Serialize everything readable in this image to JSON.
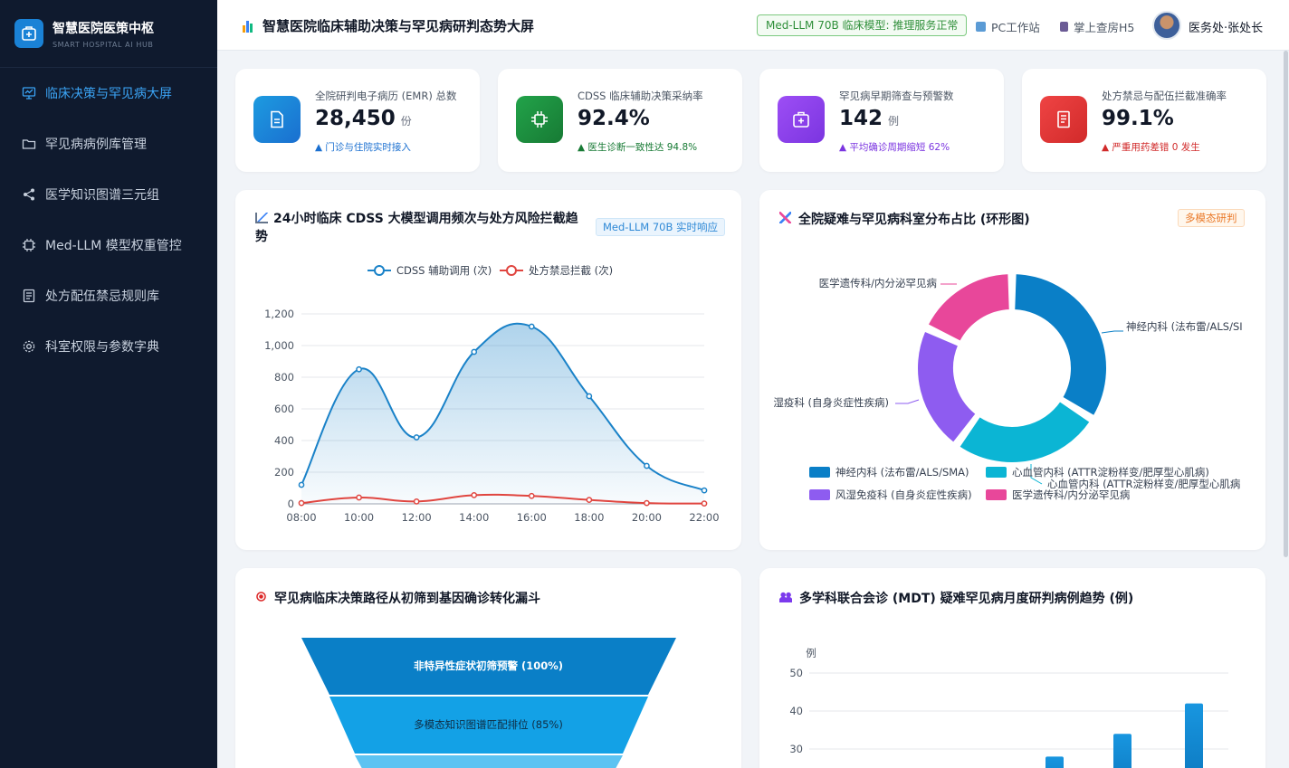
{
  "app": {
    "name": "智慧医院医策中枢",
    "subtitle": "SMART HOSPITAL AI HUB"
  },
  "sidebar": {
    "items": [
      {
        "label": "临床决策与罕见病大屏",
        "icon": "dashboard-icon",
        "active": true
      },
      {
        "label": "罕见病病例库管理",
        "icon": "folder-icon",
        "active": false
      },
      {
        "label": "医学知识图谱三元组",
        "icon": "share-icon",
        "active": false
      },
      {
        "label": "Med-LLM 模型权重管控",
        "icon": "chip-icon",
        "active": false
      },
      {
        "label": "处方配伍禁忌规则库",
        "icon": "document-icon",
        "active": false
      },
      {
        "label": "科室权限与参数字典",
        "icon": "gear-icon",
        "active": false
      }
    ]
  },
  "header": {
    "title": "智慧医院临床辅助决策与罕见病研判态势大屏",
    "model_status": "Med-LLM 70B 临床模型: 推理服务正常",
    "pc_link": "PC工作站",
    "h5_link": "掌上查房H5",
    "user": "医务处·张处长"
  },
  "kpis": [
    {
      "label": "全院研判电子病历 (EMR) 总数",
      "value": "28,450",
      "unit": "份",
      "trend": "▲ 门诊与住院实时接入",
      "color": "#1a82d6",
      "icon": "document-icon"
    },
    {
      "label": "CDSS 临床辅助决策采纳率",
      "value": "92.4%",
      "unit": "",
      "trend": "▲ 医生诊断一致性达 94.8%",
      "color": "#1f8f3c",
      "icon": "chip-icon"
    },
    {
      "label": "罕见病早期筛查与预警数",
      "value": "142",
      "unit": "例",
      "trend": "▲ 平均确诊周期缩短 62%",
      "color": "#8b3ff0",
      "icon": "medical-kit-icon"
    },
    {
      "label": "处方禁忌与配伍拦截准确率",
      "value": "99.1%",
      "unit": "",
      "trend": "▲ 严重用药差错 0 发生",
      "color": "#dc2626",
      "icon": "prescription-icon"
    }
  ],
  "colors": {
    "accent": "#1a82d6",
    "cdss_line": "#1a82c8",
    "intercept_line": "#e0453f"
  },
  "line_panel": {
    "title_line1": "24小时临床 CDSS 大模型调用频次与处方风险拦截趋",
    "title_line2": "势",
    "tag": "Med-LLM 70B 实时响应"
  },
  "donut_panel": {
    "title": "全院疑难与罕见病科室分布占比 (环形图)",
    "tag": "多模态研判",
    "label_genetics": "医学遗传科/内分泌罕见病",
    "label_neuro": "神经内科 (法布雷/ALS/SI",
    "label_rheum": "湿疫科 (自身炎症性疾病)",
    "label_cardio": "心血管内科 (ATTR淀粉样变/肥厚型心肌病"
  },
  "funnel_panel": {
    "title": "罕见病临床决策路径从初筛到基因确诊转化漏斗",
    "stages": [
      "非特异性症状初筛预警 (100%)",
      "多模态知识图谱匹配排位 (85%)"
    ]
  },
  "bar_panel": {
    "title": "多学科联合会诊 (MDT) 疑难罕见病月度研判病例趋势 (例)"
  },
  "chart_data": [
    {
      "type": "line",
      "x": [
        "08:00",
        "10:00",
        "12:00",
        "14:00",
        "16:00",
        "18:00",
        "20:00",
        "22:00"
      ],
      "series": [
        {
          "name": "CDSS 辅助调用 (次)",
          "values": [
            120,
            850,
            420,
            960,
            1120,
            680,
            240,
            85
          ]
        },
        {
          "name": "处方禁忌拦截 (次)",
          "values": [
            5,
            40,
            15,
            55,
            50,
            25,
            5,
            2
          ]
        }
      ],
      "yticks": [
        "0",
        "200",
        "400",
        "600",
        "800",
        "1,000",
        "1,200"
      ],
      "ylim": [
        0,
        1200
      ],
      "legend": "top-center",
      "grid": true
    },
    {
      "type": "pie",
      "donut": true,
      "categories": [
        "神经内科 (法布雷/ALS/SMA)",
        "心血管内科 (ATTR淀粉样变/肥厚型心肌病)",
        "风湿免疫科 (自身炎症性疾病)",
        "医学遗传科/内分泌罕见病"
      ],
      "values": [
        34,
        26,
        22,
        18
      ],
      "colors": [
        "#0a7fc7",
        "#0bb5d4",
        "#8e5cf0",
        "#e8479a"
      ],
      "legend": "bottom"
    },
    {
      "type": "bar",
      "ylabel": "例",
      "yticks": [
        "30",
        "40",
        "50"
      ],
      "values": [
        28,
        34,
        42
      ]
    }
  ]
}
